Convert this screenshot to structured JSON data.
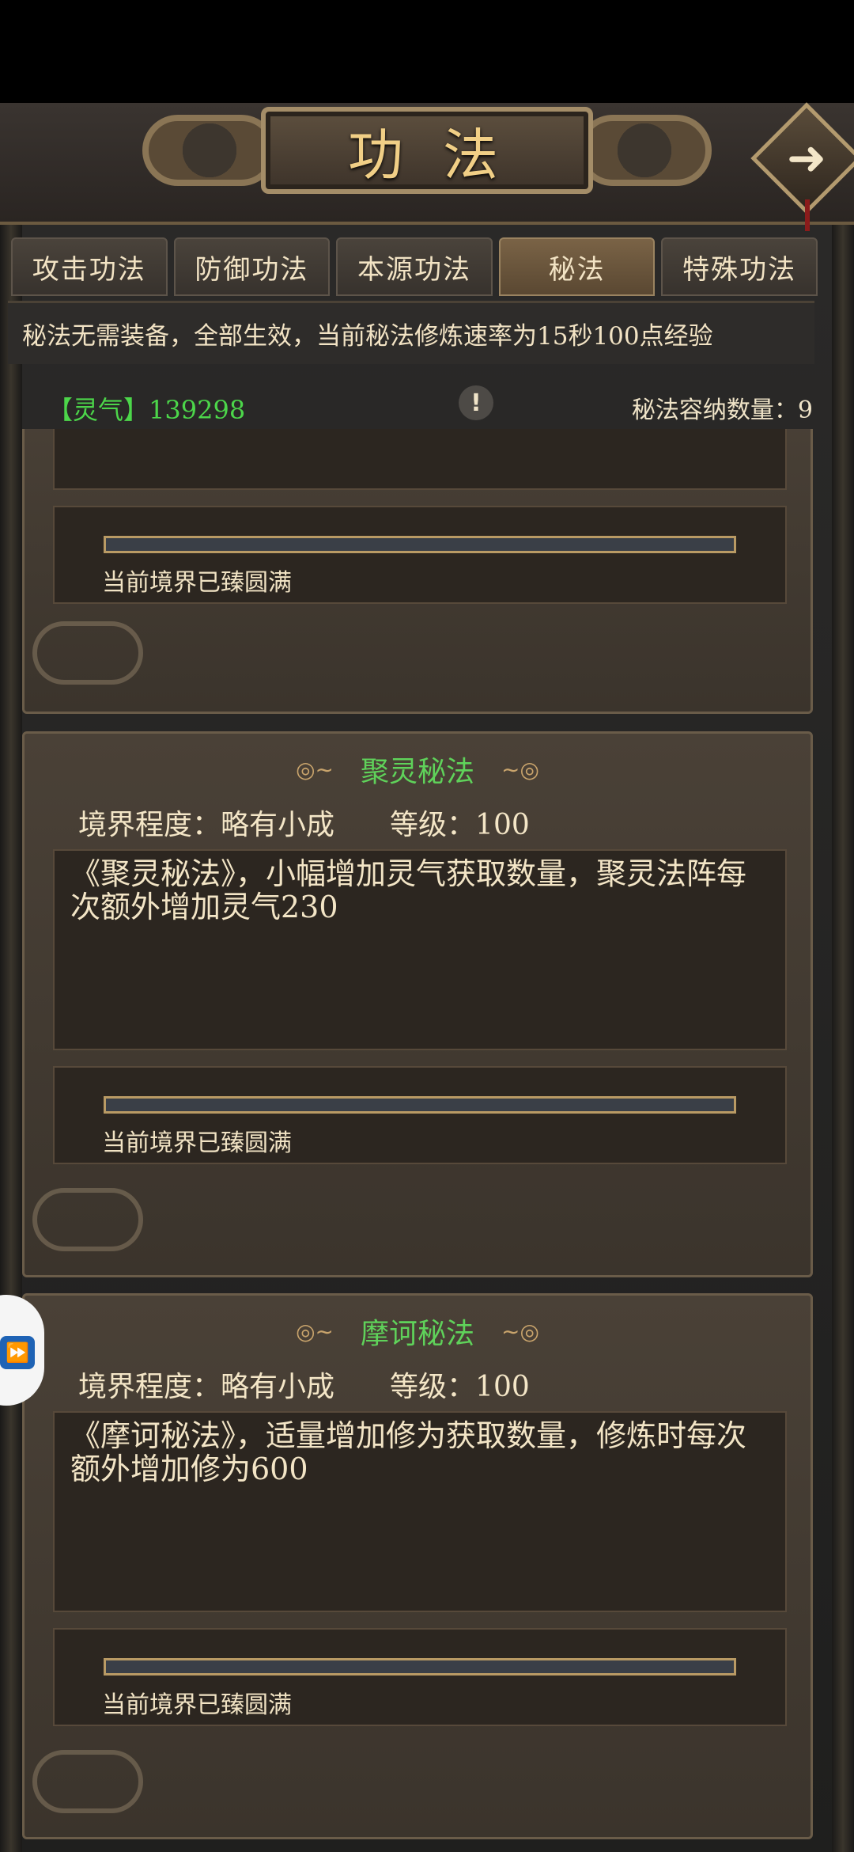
{
  "header": {
    "title": "功法"
  },
  "tabs": [
    {
      "label": "攻击功法"
    },
    {
      "label": "防御功法"
    },
    {
      "label": "本源功法"
    },
    {
      "label": "秘法",
      "active": true
    },
    {
      "label": "特殊功法"
    }
  ],
  "notice": "秘法无需装备，全部生效，当前秘法修炼速率为15秒100点经验",
  "resources": {
    "spirit_label": "【灵气】",
    "spirit_value": "139298",
    "capacity_label": "秘法容纳数量：",
    "capacity_value": "9"
  },
  "icons": {
    "next": "arrow-right-icon",
    "alert": "exclamation-icon"
  },
  "top_partial_card": {
    "progress_text": "当前境界已臻圆满",
    "progress": 1.0
  },
  "cards": [
    {
      "name": "聚灵秘法",
      "realm_label": "境界程度：",
      "realm_value": "略有小成",
      "level_label": "等级：",
      "level_value": "100",
      "description": "《聚灵秘法》，小幅增加灵气获取数量，聚灵法阵每次额外增加灵气230",
      "progress_text": "当前境界已臻圆满",
      "progress": 1.0
    },
    {
      "name": "摩诃秘法",
      "realm_label": "境界程度：",
      "realm_value": "略有小成",
      "level_label": "等级：",
      "level_value": "100",
      "description": "《摩诃秘法》，适量增加修为获取数量，修炼时每次额外增加修为600",
      "progress_text": "当前境界已臻圆满",
      "progress": 1.0
    }
  ],
  "colors": {
    "accent_green": "#5fd25a",
    "gold": "#f1cf86"
  }
}
